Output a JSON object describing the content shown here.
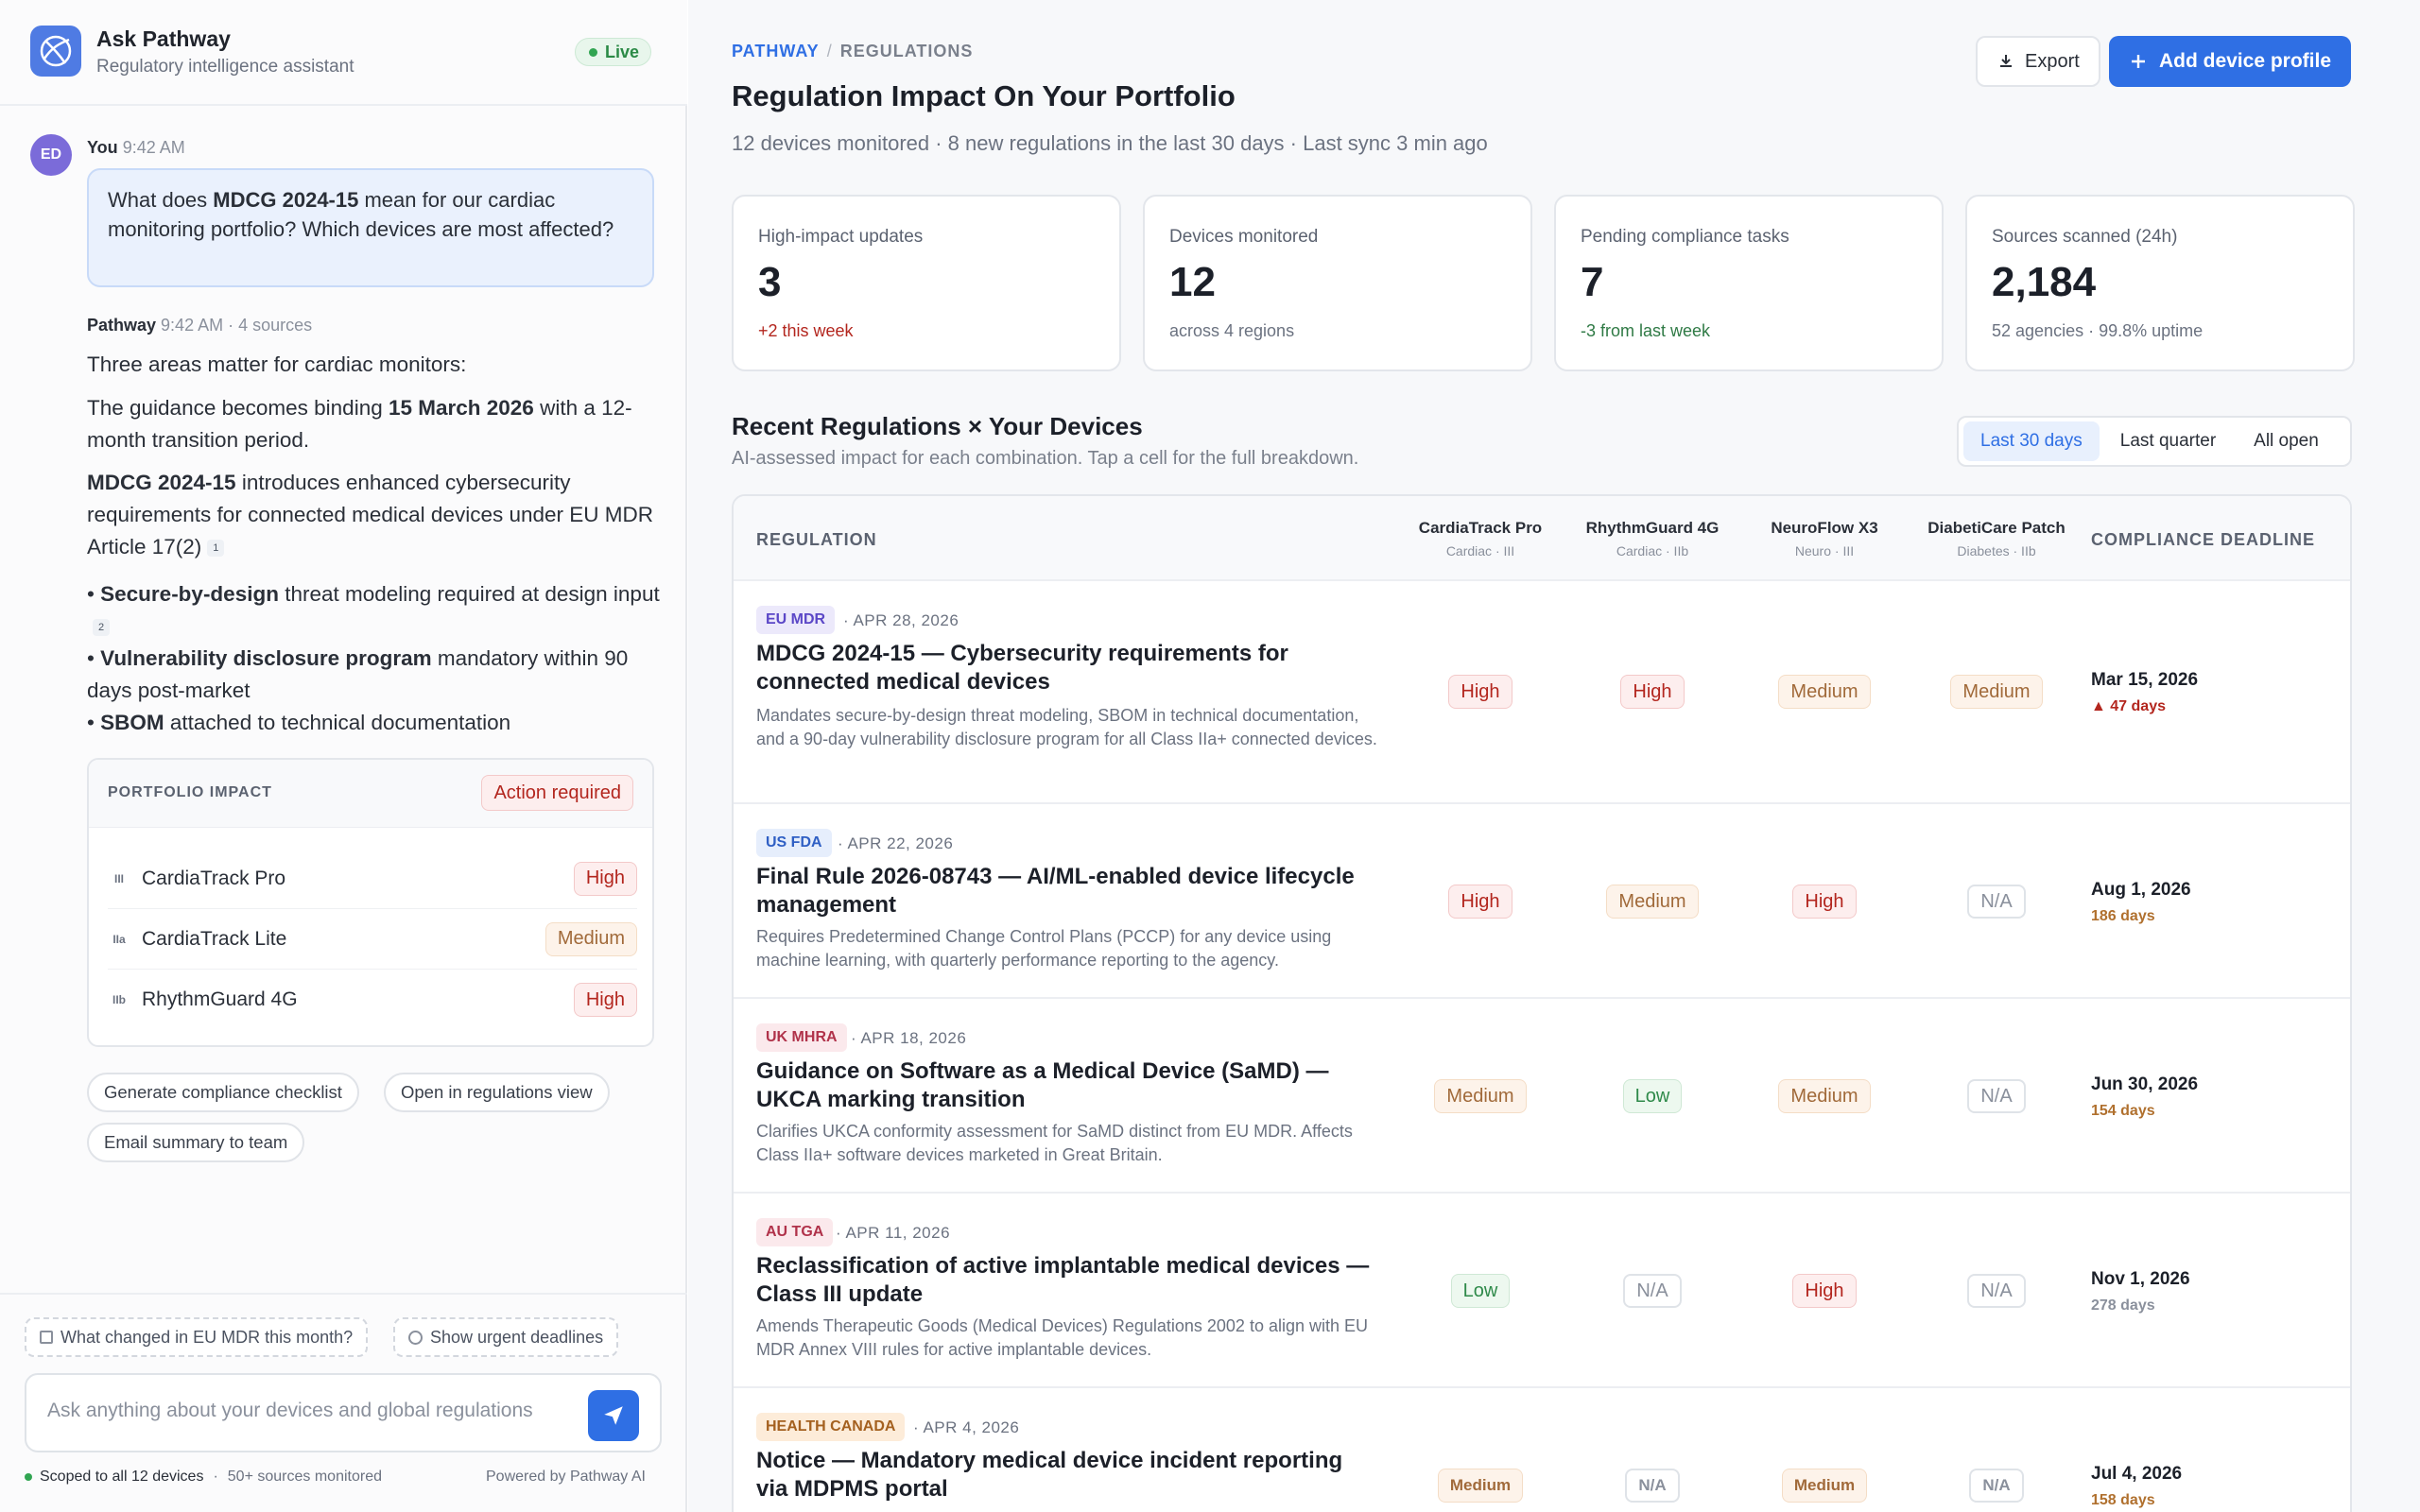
{
  "assistant": {
    "title": "Ask Pathway",
    "subtitle": "Regulatory intelligence assistant",
    "live_label": "Live",
    "user_initials": "ED",
    "user_name": "You",
    "user_time": "9:42 AM",
    "question_parts": [
      "What does ",
      "MDCG 2024-15",
      " mean for our cardiac monitoring portfolio? Which devices are most affected?"
    ],
    "bot_name": "Pathway",
    "bot_meta": "9:42 AM · 4 sources",
    "answer": {
      "intro": "Three areas matter for cardiac monitors:",
      "binding_pre": "The guidance becomes binding ",
      "binding_date": "15 March 2026",
      "binding_post": " with a 12-month transition period.",
      "mdcg_bold": "MDCG 2024-15",
      "mdcg_rest": " introduces enhanced cybersecurity requirements for connected medical devices under EU MDR Article 17(2)",
      "ref1": "1",
      "bullet1_bold": "Secure-by-design",
      "bullet1_rest": " threat modeling required at design input",
      "ref2": "2",
      "bullet2_bold": "Vulnerability disclosure program",
      "bullet2_rest": " mandatory within 90 days post-market",
      "bullet3_bold": "SBOM",
      "bullet3_rest": " attached to technical documentation"
    },
    "portfolio": {
      "title": "PORTFOLIO IMPACT",
      "action": "Action required",
      "items": [
        {
          "cls": "III",
          "name": "CardiaTrack Pro",
          "impact": "High"
        },
        {
          "cls": "IIa",
          "name": "CardiaTrack Lite",
          "impact": "Medium"
        },
        {
          "cls": "IIb",
          "name": "RhythmGuard 4G",
          "impact": "High"
        }
      ]
    },
    "actions": [
      "Generate compliance checklist",
      "Open in regulations view",
      "Email summary to team"
    ],
    "suggestions": [
      "What changed in EU MDR this month?",
      "Show urgent deadlines"
    ],
    "input_placeholder": "Ask anything about your devices and global regulations",
    "footer_scope": "Scoped to all 12 devices",
    "footer_sources": "50+ sources monitored",
    "footer_powered": "Powered by Pathway AI"
  },
  "main": {
    "breadcrumb": [
      "PATHWAY",
      "REGULATIONS"
    ],
    "title": "Regulation Impact On Your Portfolio",
    "subtitle": "12 devices monitored · 8 new regulations in the last 30 days · Last sync 3 min ago",
    "export_label": "Export",
    "add_label": "Add device profile",
    "stats": [
      {
        "label": "High-impact updates",
        "value": "3",
        "note": "+2 this week"
      },
      {
        "label": "Devices monitored",
        "value": "12",
        "note": "across 4 regions"
      },
      {
        "label": "Pending compliance tasks",
        "value": "7",
        "note": "-3 from last week"
      },
      {
        "label": "Sources scanned (24h)",
        "value": "2,184",
        "note": "52 agencies · 99.8% uptime"
      }
    ],
    "section_title": "Recent Regulations × Your Devices",
    "section_sub": "AI-assessed impact for each combination. Tap a cell for the full breakdown.",
    "filters": [
      "Last 30 days",
      "Last quarter",
      "All open"
    ],
    "table": {
      "col_regulation": "REGULATION",
      "col_deadline": "COMPLIANCE DEADLINE",
      "devices": [
        {
          "name": "CardiaTrack Pro",
          "cls": "Cardiac · III"
        },
        {
          "name": "RhythmGuard 4G",
          "cls": "Cardiac · IIb"
        },
        {
          "name": "NeuroFlow X3",
          "cls": "Neuro · III"
        },
        {
          "name": "DiabetiCare Patch",
          "cls": "Diabetes · IIb"
        }
      ],
      "rows": [
        {
          "tag": "EU MDR",
          "date": "· APR 28, 2026",
          "title": "MDCG 2024-15 — Cybersecurity requirements for connected medical devices",
          "desc": "Mandates secure-by-design threat modeling, SBOM in technical documentation, and a 90-day vulnerability disclosure program for all Class IIa+ connected devices.",
          "impacts": [
            "High",
            "High",
            "Medium",
            "Medium"
          ],
          "deadline": "Mar 15, 2026",
          "remaining": "▲ 47 days"
        },
        {
          "tag": "US FDA",
          "date": "· APR 22, 2026",
          "title": "Final Rule 2026-08743 — AI/ML-enabled device lifecycle management",
          "desc": "Requires Predetermined Change Control Plans (PCCP) for any device using machine learning, with quarterly performance reporting to the agency.",
          "impacts": [
            "High",
            "Medium",
            "High",
            "N/A"
          ],
          "deadline": "Aug 1, 2026",
          "remaining": "186 days"
        },
        {
          "tag": "UK MHRA",
          "date": "· APR 18, 2026",
          "title": "Guidance on Software as a Medical Device (SaMD) — UKCA marking transition",
          "desc": "Clarifies UKCA conformity assessment for SaMD distinct from EU MDR. Affects Class IIa+ software devices marketed in Great Britain.",
          "impacts": [
            "Medium",
            "Low",
            "Medium",
            "N/A"
          ],
          "deadline": "Jun 30, 2026",
          "remaining": "154 days"
        },
        {
          "tag": "AU TGA",
          "date": "· APR 11, 2026",
          "title": "Reclassification of active implantable medical devices — Class III update",
          "desc": "Amends Therapeutic Goods (Medical Devices) Regulations 2002 to align with EU MDR Annex VIII rules for active implantable devices.",
          "impacts": [
            "Low",
            "N/A",
            "High",
            "N/A"
          ],
          "deadline": "Nov 1, 2026",
          "remaining": "278 days"
        },
        {
          "tag": "HEALTH CANADA",
          "date": "· APR 4, 2026",
          "title": "Notice — Mandatory medical device incident reporting via MDPMS portal",
          "desc": "",
          "impacts": [
            "Medium",
            "N/A",
            "Medium",
            "N/A"
          ],
          "deadline": "Jul 4, 2026",
          "remaining": "158 days"
        }
      ]
    }
  },
  "colors": {
    "accent": "#2f6fe4",
    "high": "#b3261e",
    "medium": "#a16a3a",
    "low": "#2f8a4a",
    "live": "#31a552"
  }
}
